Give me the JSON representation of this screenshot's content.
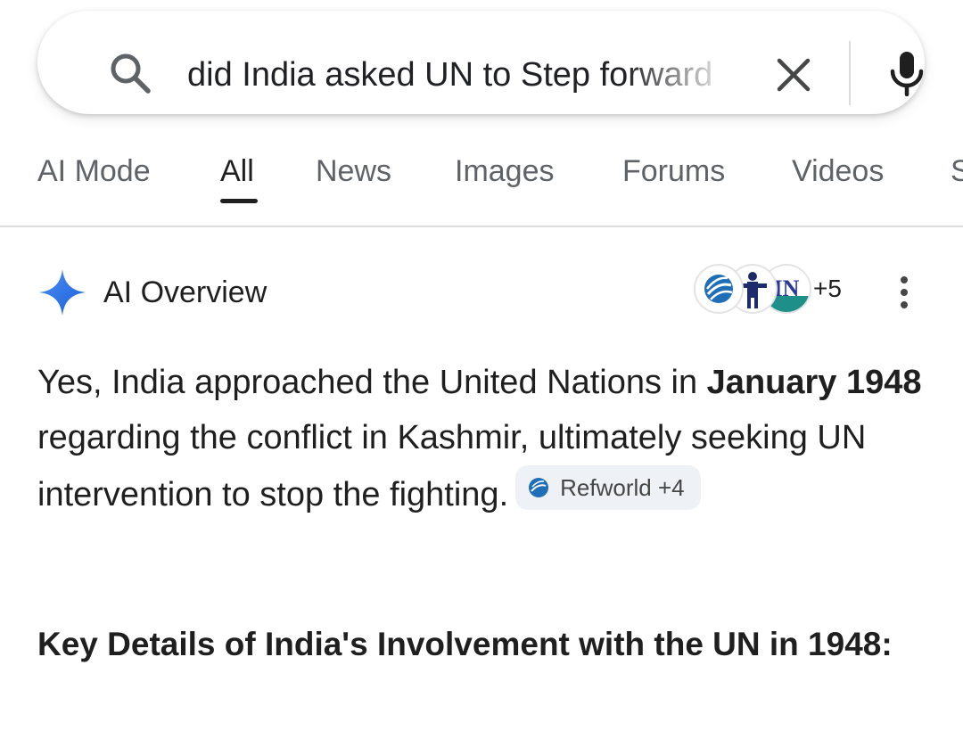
{
  "search": {
    "query": "did India asked UN to Step forward"
  },
  "tabs": [
    {
      "label": "AI Mode"
    },
    {
      "label": "All"
    },
    {
      "label": "News"
    },
    {
      "label": "Images"
    },
    {
      "label": "Forums"
    },
    {
      "label": "Videos"
    },
    {
      "label": "S"
    }
  ],
  "ai_overview": {
    "title": "AI Overview",
    "sources_more": "+5",
    "source_icons": [
      "refworld-globe-icon",
      "person-figure-icon",
      "un-logo-icon"
    ],
    "answer": {
      "part1": "Yes, India approached the United Nations in ",
      "bold1": "January 1948",
      "part2": " regarding the conflict in Kashmir, ultimately seeking UN intervention to stop the fighting.",
      "chip_label": "Refworld +4"
    },
    "heading": "Key Details of India's Involvement with the UN in 1948:"
  },
  "colors": {
    "accent_blue": "#1a73e8",
    "text": "#1f1f1f",
    "muted": "#5f6368",
    "chip_bg": "#eef1f6"
  }
}
